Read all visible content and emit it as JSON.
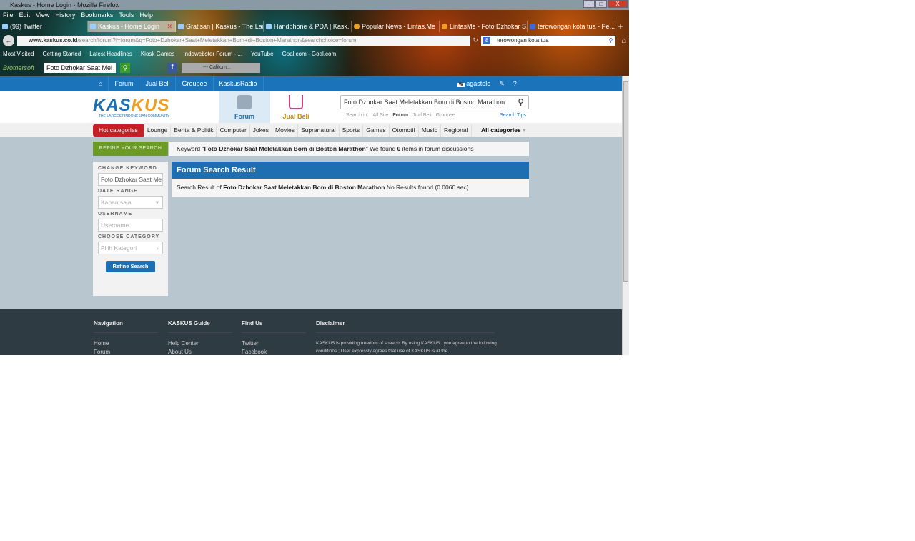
{
  "window": {
    "title": "Kaskus - Home Login - Mozilla Firefox",
    "controls": [
      "–",
      "□",
      "X"
    ]
  },
  "menu": [
    "File",
    "Edit",
    "View",
    "History",
    "Bookmarks",
    "Tools",
    "Help"
  ],
  "tabs": [
    {
      "label": "(99) Twitter"
    },
    {
      "label": "Kaskus - Home Login",
      "active": true
    },
    {
      "label": "Gratisan | Kaskus - The Lar..."
    },
    {
      "label": "Handphone & PDA | Kask..."
    },
    {
      "label": "Popular News - Lintas.Me"
    },
    {
      "label": "LintasMe - Foto Dzhokar S..."
    },
    {
      "label": "terowongan kota tua - Pe..."
    }
  ],
  "address": {
    "host": "www.kaskus.co.id",
    "path": "/search/forum?f=forum&q=Foto+Dzhokar+Saat+Meletakkan+Bom+di+Boston+Marathon&searchchoice=forum"
  },
  "browser_search": "terowongan kota tua",
  "bookmarks": [
    "Most Visited",
    "Getting Started",
    "Latest Headlines",
    "Kiosk Games",
    "Indowebster Forum - ...",
    "YouTube",
    "Goal.com - Goal.com"
  ],
  "toolbar": {
    "brand": "Brothersoft",
    "search_value": "Foto Dzhokar Saat Mel",
    "player_station": "--- Californ..."
  },
  "site": {
    "topnav": [
      "Forum",
      "Jual Beli",
      "Groupee",
      "KaskusRadio"
    ],
    "username": "agastole",
    "logo": {
      "word_a": "KAS",
      "word_b": "KUS",
      "tagline": "THE LARGEST INDONESIAN COMMUNITY"
    },
    "hnav": {
      "forum": "Forum",
      "jual_beli": "Jual Beli"
    },
    "search_value": "Foto Dzhokar Saat Meletakkan Bom di Boston Marathon",
    "search_in_label": "Search in:",
    "search_in": [
      "All Site",
      "Forum",
      "Jual Beli",
      "Groupee"
    ],
    "search_tips": "Search Tips",
    "hot": "Hot categories",
    "categories": [
      "Lounge",
      "Berita & Politik",
      "Computer",
      "Jokes",
      "Movies",
      "Supranatural",
      "Sports",
      "Games",
      "Otomotif",
      "Music",
      "Regional"
    ],
    "all_categories": "All categories"
  },
  "refine": {
    "header": "REFINE YOUR SEARCH",
    "keyword_label": "CHANGE KEYWORD",
    "keyword_value": "Foto Dzhokar Saat Meletakkan",
    "date_label": "DATE RANGE",
    "date_value": "Kapan saja",
    "username_label": "USERNAME",
    "username_placeholder": "Username",
    "category_label": "CHOOSE CATEGORY",
    "category_value": "Pilih Kategori",
    "button": "Refine Search"
  },
  "keyword_bar": {
    "prefix": "Keyword \"",
    "keyword": "Foto Dzhokar Saat Meletakkan Bom di Boston Marathon",
    "mid": "\" We found ",
    "count": "0",
    "suffix": " items in forum discussions"
  },
  "result": {
    "title": "Forum Search Result",
    "prefix": "Search Result of ",
    "keyword": "Foto Dzhokar Saat Meletakkan Bom di Boston Marathon",
    "suffix": " No Results found (0.0060 sec)"
  },
  "footer": {
    "nav": {
      "title": "Navigation",
      "items": [
        "Home",
        "Forum"
      ]
    },
    "guide": {
      "title": "KASKUS Guide",
      "items": [
        "Help Center",
        "About Us"
      ]
    },
    "find": {
      "title": "Find Us",
      "items": [
        "Twitter",
        "Facebook"
      ]
    },
    "disclaimer": {
      "title": "Disclaimer",
      "text": "KASKUS is providing freedom of speech. By using KASKUS , you agree to the following conditions ; User expressly agrees that use of KASKUS is at the"
    }
  }
}
